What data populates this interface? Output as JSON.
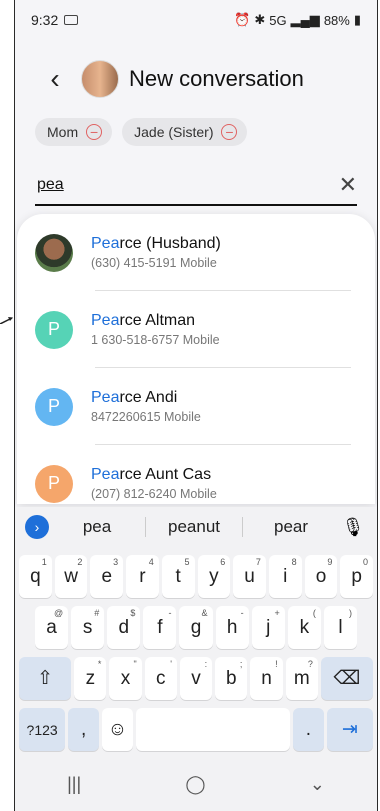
{
  "status": {
    "time": "9:32",
    "signal": "5G",
    "battery": "88%"
  },
  "header": {
    "title": "New conversation"
  },
  "chips": [
    {
      "label": "Mom"
    },
    {
      "label": "Jade (Sister)"
    }
  ],
  "search": {
    "value": "pea"
  },
  "results": [
    {
      "match": "Pea",
      "rest": "rce (Husband)",
      "phone": "(630) 415-5191",
      "type": "Mobile",
      "initial": ""
    },
    {
      "match": "Pea",
      "rest": "rce Altman",
      "phone": "1 630-518-6757",
      "type": "Mobile",
      "initial": "P",
      "color": "#56d3b6"
    },
    {
      "match": "Pea",
      "rest": "rce Andi",
      "phone": "8472260615",
      "type": "Mobile",
      "initial": "P",
      "color": "#63b6f2"
    },
    {
      "match": "Pea",
      "rest": "rce Aunt Cas",
      "phone": "(207) 812-6240",
      "type": "Mobile",
      "initial": "P",
      "color": "#f5a66b"
    }
  ],
  "keyboard": {
    "suggestions": [
      "pea",
      "peanut",
      "pear"
    ],
    "row1": [
      {
        "k": "q",
        "h": "1"
      },
      {
        "k": "w",
        "h": "2"
      },
      {
        "k": "e",
        "h": "3"
      },
      {
        "k": "r",
        "h": "4"
      },
      {
        "k": "t",
        "h": "5"
      },
      {
        "k": "y",
        "h": "6"
      },
      {
        "k": "u",
        "h": "7"
      },
      {
        "k": "i",
        "h": "8"
      },
      {
        "k": "o",
        "h": "9"
      },
      {
        "k": "p",
        "h": "0"
      }
    ],
    "row2": [
      {
        "k": "a",
        "h": "@"
      },
      {
        "k": "s",
        "h": "#"
      },
      {
        "k": "d",
        "h": "$"
      },
      {
        "k": "f",
        "h": "-"
      },
      {
        "k": "g",
        "h": "&"
      },
      {
        "k": "h",
        "h": "-"
      },
      {
        "k": "j",
        "h": "+"
      },
      {
        "k": "k",
        "h": "("
      },
      {
        "k": "l",
        "h": ")"
      }
    ],
    "row3": [
      {
        "k": "z",
        "h": "*"
      },
      {
        "k": "x",
        "h": "\""
      },
      {
        "k": "c",
        "h": "'"
      },
      {
        "k": "v",
        "h": ":"
      },
      {
        "k": "b",
        "h": ";"
      },
      {
        "k": "n",
        "h": "!"
      },
      {
        "k": "m",
        "h": "?"
      }
    ],
    "sym_label": "?123",
    "comma": ",",
    "period": "."
  }
}
